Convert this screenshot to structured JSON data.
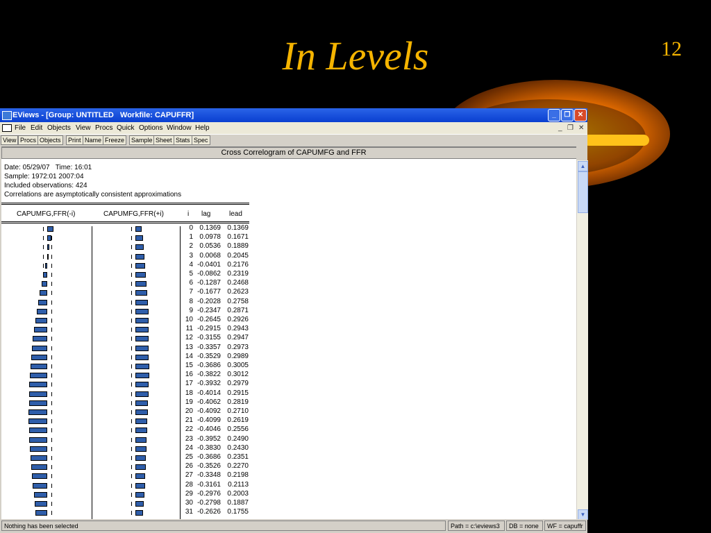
{
  "slide": {
    "title": "In Levels",
    "number": "12"
  },
  "window": {
    "title": "EViews - [Group: UNTITLED   Workfile: CAPUFFR]",
    "controls": {
      "minimize": "_",
      "maximize": "❐",
      "close": "✕"
    },
    "mdi_controls": [
      "_",
      "❐",
      "✕"
    ]
  },
  "menu": [
    "File",
    "Edit",
    "Objects",
    "View",
    "Procs",
    "Quick",
    "Options",
    "Window",
    "Help"
  ],
  "toolbar": [
    "View",
    "Procs",
    "Objects",
    "Print",
    "Name",
    "Freeze",
    "Sample",
    "Sheet",
    "Stats",
    "Spec"
  ],
  "view": {
    "heading": "Cross Correlogram of CAPUMFG and FFR",
    "info": [
      "Date: 05/29/07   Time: 16:01",
      "Sample: 1972:01 2007:04",
      "Included observations: 424",
      "Correlations are asymptotically consistent approximations"
    ],
    "columns": {
      "left_graph": "CAPUMFG,FFR(-i)",
      "right_graph": "CAPUMFG,FFR(+i)",
      "i": "i",
      "lag": "lag",
      "lead": "lead"
    },
    "rows": [
      {
        "i": "0",
        "lag": "0.1369",
        "lead": "0.1369"
      },
      {
        "i": "1",
        "lag": "0.0978",
        "lead": "0.1671"
      },
      {
        "i": "2",
        "lag": "0.0536",
        "lead": "0.1889"
      },
      {
        "i": "3",
        "lag": "0.0068",
        "lead": "0.2045"
      },
      {
        "i": "4",
        "lag": "-0.0401",
        "lead": "0.2176"
      },
      {
        "i": "5",
        "lag": "-0.0862",
        "lead": "0.2319"
      },
      {
        "i": "6",
        "lag": "-0.1287",
        "lead": "0.2468"
      },
      {
        "i": "7",
        "lag": "-0.1677",
        "lead": "0.2623"
      },
      {
        "i": "8",
        "lag": "-0.2028",
        "lead": "0.2758"
      },
      {
        "i": "9",
        "lag": "-0.2347",
        "lead": "0.2871"
      },
      {
        "i": "10",
        "lag": "-0.2645",
        "lead": "0.2926"
      },
      {
        "i": "11",
        "lag": "-0.2915",
        "lead": "0.2943"
      },
      {
        "i": "12",
        "lag": "-0.3155",
        "lead": "0.2947"
      },
      {
        "i": "13",
        "lag": "-0.3357",
        "lead": "0.2973"
      },
      {
        "i": "14",
        "lag": "-0.3529",
        "lead": "0.2989"
      },
      {
        "i": "15",
        "lag": "-0.3686",
        "lead": "0.3005"
      },
      {
        "i": "16",
        "lag": "-0.3822",
        "lead": "0.3012"
      },
      {
        "i": "17",
        "lag": "-0.3932",
        "lead": "0.2979"
      },
      {
        "i": "18",
        "lag": "-0.4014",
        "lead": "0.2915"
      },
      {
        "i": "19",
        "lag": "-0.4062",
        "lead": "0.2819"
      },
      {
        "i": "20",
        "lag": "-0.4092",
        "lead": "0.2710"
      },
      {
        "i": "21",
        "lag": "-0.4099",
        "lead": "0.2619"
      },
      {
        "i": "22",
        "lag": "-0.4046",
        "lead": "0.2556"
      },
      {
        "i": "23",
        "lag": "-0.3952",
        "lead": "0.2490"
      },
      {
        "i": "24",
        "lag": "-0.3830",
        "lead": "0.2430"
      },
      {
        "i": "25",
        "lag": "-0.3686",
        "lead": "0.2351"
      },
      {
        "i": "26",
        "lag": "-0.3526",
        "lead": "0.2270"
      },
      {
        "i": "27",
        "lag": "-0.3348",
        "lead": "0.2198"
      },
      {
        "i": "28",
        "lag": "-0.3161",
        "lead": "0.2113"
      },
      {
        "i": "29",
        "lag": "-0.2976",
        "lead": "0.2003"
      },
      {
        "i": "30",
        "lag": "-0.2798",
        "lead": "0.1887"
      },
      {
        "i": "31",
        "lag": "-0.2626",
        "lead": "0.1755"
      }
    ]
  },
  "status": {
    "message": "Nothing has been selected",
    "path": "Path = c:\\eviews3",
    "db": "DB = none",
    "wf": "WF = capuffr"
  },
  "colors": {
    "title_accent": "#f5b400",
    "bar_fill": "#2f5eaa",
    "titlebar": "#0a3fd0"
  }
}
